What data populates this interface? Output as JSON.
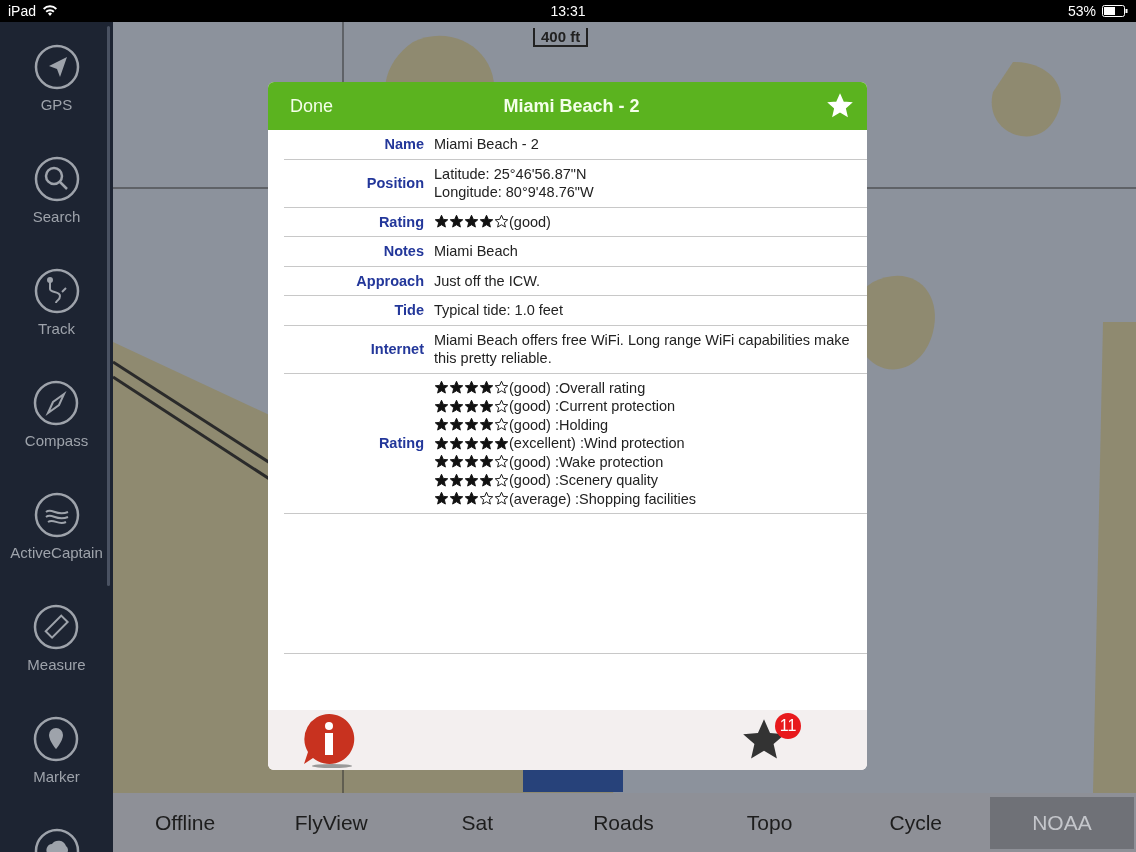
{
  "status_bar": {
    "device": "iPad",
    "time": "13:31",
    "battery": "53%"
  },
  "sidebar": {
    "items": [
      {
        "kind": "gps",
        "label": "GPS"
      },
      {
        "kind": "search",
        "label": "Search"
      },
      {
        "kind": "track",
        "label": "Track"
      },
      {
        "kind": "compass",
        "label": "Compass"
      },
      {
        "kind": "activecaptain",
        "label": "ActiveCaptain"
      },
      {
        "kind": "measure",
        "label": "Measure"
      },
      {
        "kind": "marker",
        "label": "Marker"
      },
      {
        "kind": "weather"
      }
    ]
  },
  "map": {
    "scale": "400 ft"
  },
  "dialog": {
    "done": "Done",
    "title": "Miami Beach - 2",
    "favorite": true,
    "fields": [
      {
        "kind": "text",
        "label": "Name",
        "lines": [
          "Miami Beach - 2"
        ]
      },
      {
        "kind": "text",
        "label": "Position",
        "lines": [
          "Latitude: 25°46'56.87\"N",
          "Longitude: 80°9'48.76\"W"
        ]
      },
      {
        "kind": "stars",
        "label": "Rating",
        "ratings": [
          {
            "stars": 4,
            "text": "(good)"
          }
        ]
      },
      {
        "kind": "text",
        "label": "Notes",
        "lines": [
          "Miami Beach"
        ]
      },
      {
        "kind": "text",
        "label": "Approach",
        "lines": [
          "Just off the ICW."
        ]
      },
      {
        "kind": "text",
        "label": "Tide",
        "lines": [
          "Typical tide: 1.0 feet"
        ]
      },
      {
        "kind": "text",
        "label": "Internet",
        "lines": [
          "Miami Beach offers free WiFi.  Long range WiFi capabilities make this pretty reliable."
        ]
      },
      {
        "kind": "stars",
        "label": "Rating",
        "ratings": [
          {
            "stars": 4,
            "text": "(good) :Overall rating"
          },
          {
            "stars": 4,
            "text": "(good) :Current protection"
          },
          {
            "stars": 4,
            "text": "(good) :Holding"
          },
          {
            "stars": 5,
            "text": "(excellent) :Wind protection"
          },
          {
            "stars": 4,
            "text": "(good) :Wake protection"
          },
          {
            "stars": 4,
            "text": "(good) :Scenery quality"
          },
          {
            "stars": 3,
            "text": "(average) :Shopping facilities"
          }
        ]
      }
    ],
    "badge": "11"
  },
  "layers": [
    {
      "label": "Offline",
      "selected": false
    },
    {
      "label": "FlyView",
      "selected": false
    },
    {
      "label": "Sat",
      "selected": false
    },
    {
      "label": "Roads",
      "selected": false
    },
    {
      "label": "Topo",
      "selected": false
    },
    {
      "label": "Cycle",
      "selected": false
    },
    {
      "label": "NOAA",
      "selected": true
    }
  ]
}
